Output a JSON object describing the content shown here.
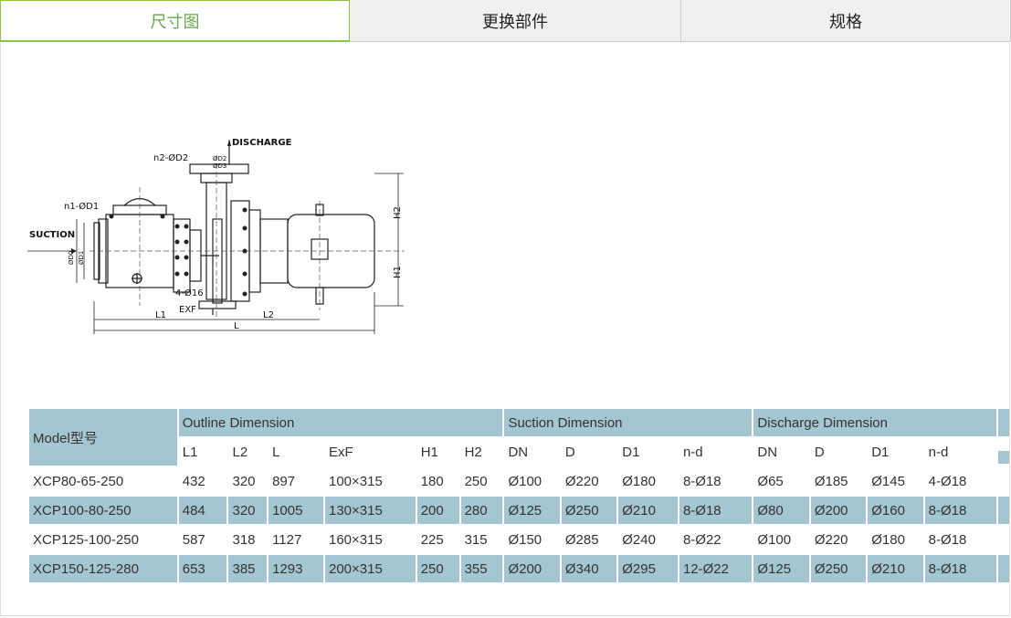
{
  "tabs": [
    {
      "label": "尺寸图",
      "active": true
    },
    {
      "label": "更换部件",
      "active": false
    },
    {
      "label": "规格",
      "active": false
    }
  ],
  "drawing": {
    "discharge": "DISCHARGE",
    "suction": "SUCTION",
    "n2": "n2-ØD2",
    "n1": "n1-ØD1",
    "d2": "ØD2",
    "d3": "ØD3",
    "d0": "ØD0",
    "d1": "ØD1",
    "bolts": "4-Ø16",
    "exf": "EXF",
    "l1": "L1",
    "l2": "L2",
    "l": "L",
    "h1": "H1",
    "h2": "H2"
  },
  "table": {
    "model_header": "Model型号",
    "groups": [
      "Outline Dimension",
      "Suction  Dimension",
      "Discharge Dimension"
    ],
    "columns": [
      "L1",
      "L2",
      "L",
      "ExF",
      "H1",
      "H2",
      "DN",
      "D",
      "D1",
      "n-d",
      "DN",
      "D",
      "D1",
      "n-d"
    ],
    "rows": [
      [
        "XCP80-65-250",
        "432",
        "320",
        "897",
        "100×315",
        "180",
        "250",
        "Ø100",
        "Ø220",
        "Ø180",
        "8-Ø18",
        "Ø65",
        "Ø185",
        "Ø145",
        "4-Ø18"
      ],
      [
        "XCP100-80-250",
        "484",
        "320",
        "1005",
        "130×315",
        "200",
        "280",
        "Ø125",
        "Ø250",
        "Ø210",
        "8-Ø18",
        "Ø80",
        "Ø200",
        "Ø160",
        "8-Ø18"
      ],
      [
        "XCP125-100-250",
        "587",
        "318",
        "1127",
        "160×315",
        "225",
        "315",
        "Ø150",
        "Ø285",
        "Ø240",
        "8-Ø22",
        "Ø100",
        "Ø220",
        "Ø180",
        "8-Ø18"
      ],
      [
        "XCP150-125-280",
        "653",
        "385",
        "1293",
        "200×315",
        "250",
        "355",
        "Ø200",
        "Ø340",
        "Ø295",
        "12-Ø22",
        "Ø125",
        "Ø250",
        "Ø210",
        "8-Ø18"
      ]
    ]
  },
  "colors": {
    "accent": "#8cc63f",
    "table_header": "#a4c6d2"
  }
}
